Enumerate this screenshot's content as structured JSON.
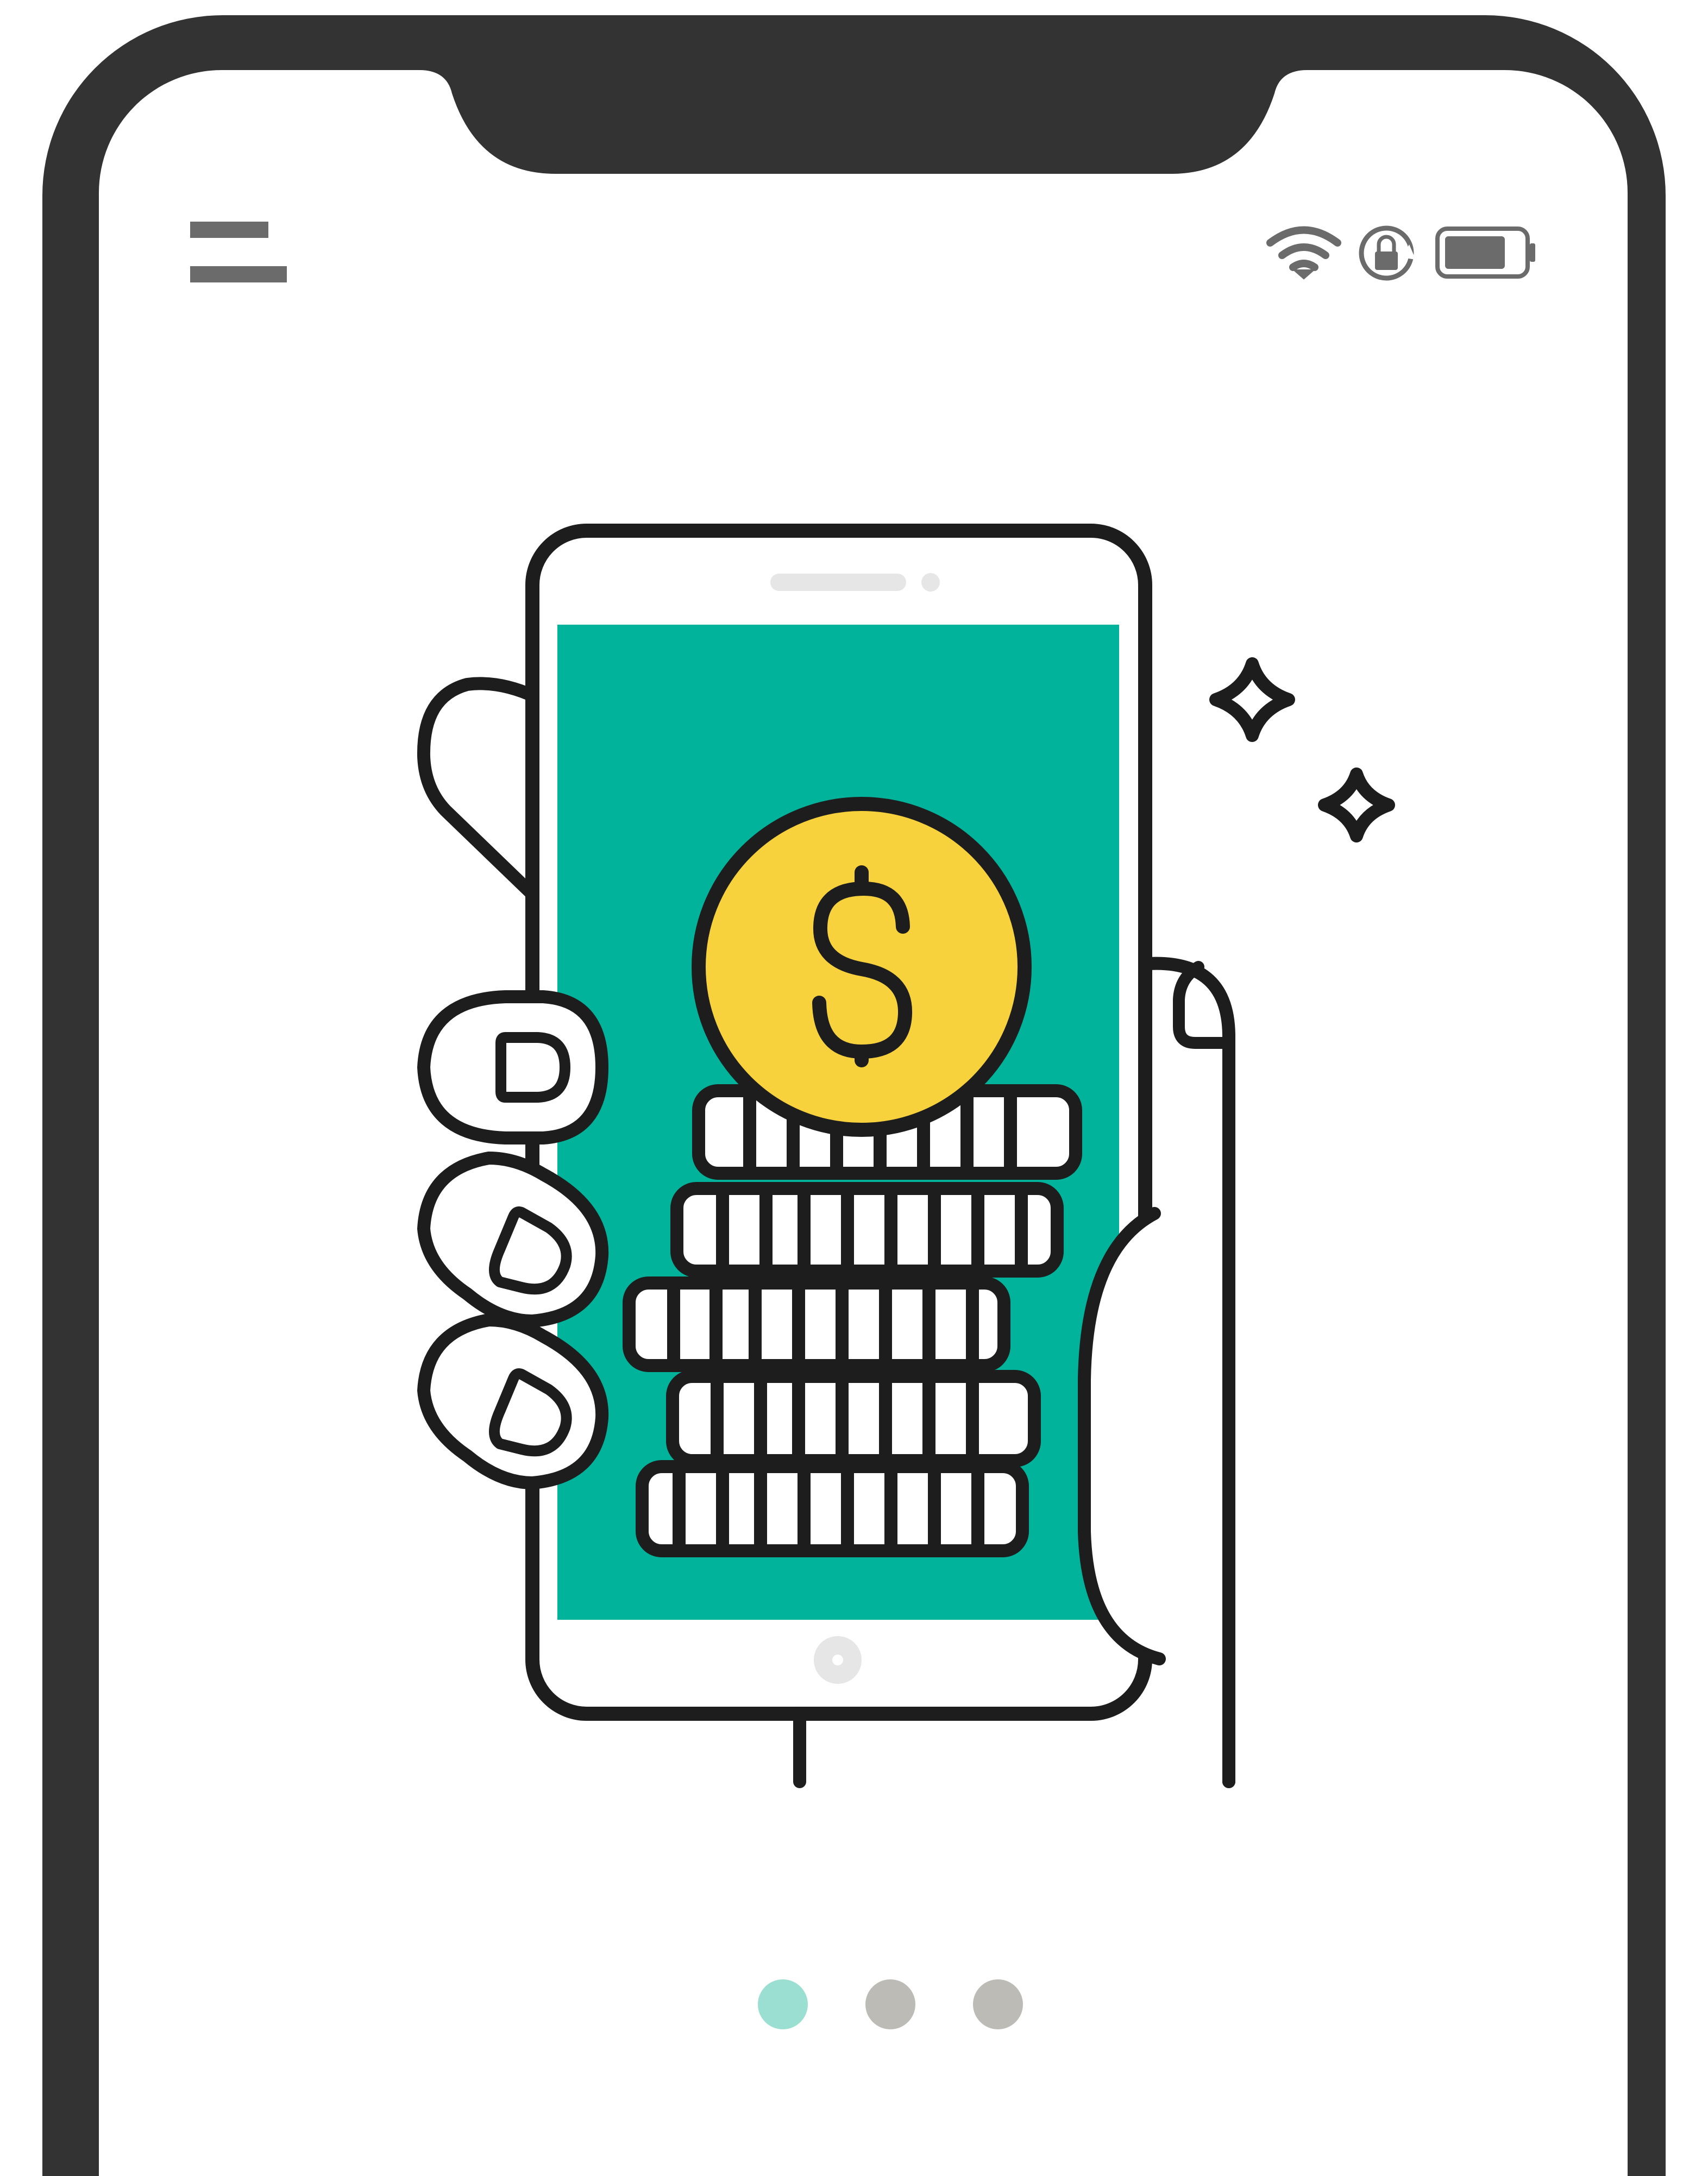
{
  "status_bar": {
    "icons": [
      "wifi-icon",
      "rotation-lock-icon",
      "battery-icon"
    ],
    "battery_level": 0.8
  },
  "header": {
    "menu_icon": "menu-icon"
  },
  "illustration": {
    "name": "hand-holding-phone-with-coins",
    "currency_symbol": "$",
    "coin_stack_count": 5,
    "sparkle_count": 2
  },
  "pagination": {
    "total": 3,
    "active_index": 0
  },
  "colors": {
    "device_frame": "#333333",
    "screen_bg": "#ffffff",
    "line": "#1d1d1d",
    "teal": "#00b39a",
    "coin_yellow": "#f8d23d",
    "dot_active": "#9bdfd3",
    "dot_inactive": "#bcbbb6",
    "icon_gray": "#6b6b6b",
    "light_gray": "#e6e6e6"
  }
}
